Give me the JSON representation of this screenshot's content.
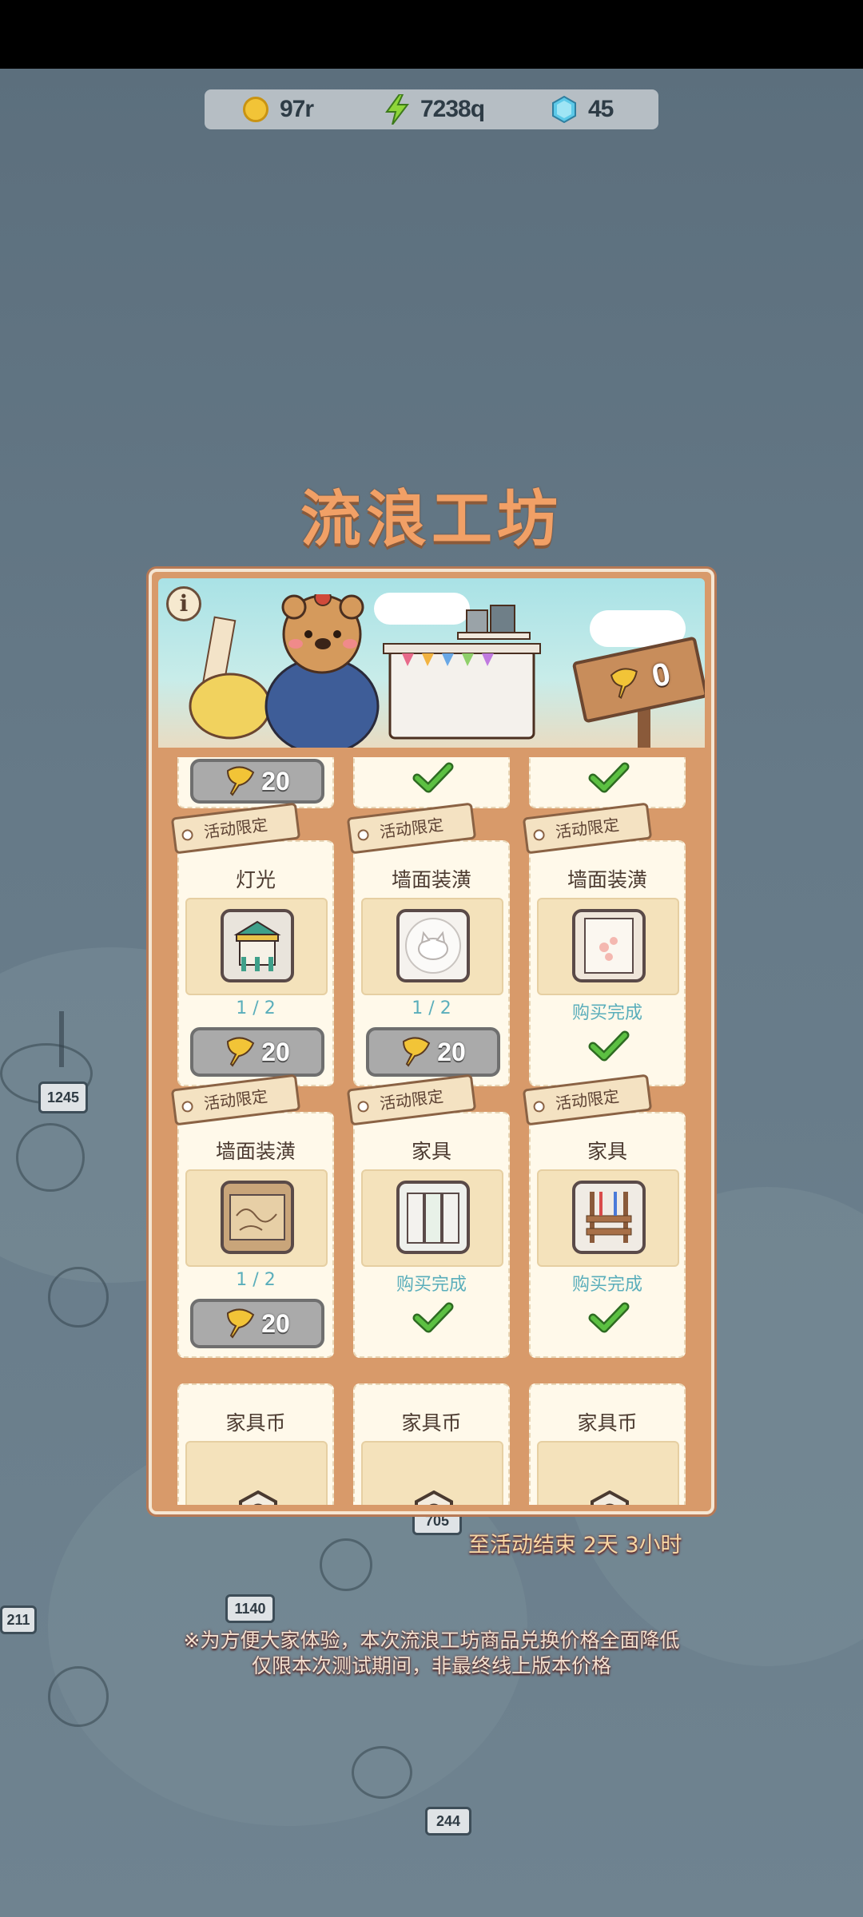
{
  "resources": {
    "coins": "97r",
    "energy": "7238q",
    "gems": "45"
  },
  "title": "流浪工坊",
  "banner": {
    "info_label": "i",
    "counter_value": "0"
  },
  "partial_row": [
    {
      "price": "20"
    }
  ],
  "rows": [
    [
      {
        "tag": "活动限定",
        "category": "灯光",
        "progress": "1 / 2",
        "price": "20"
      },
      {
        "tag": "活动限定",
        "category": "墙面装潢",
        "progress": "1 / 2",
        "price": "20"
      },
      {
        "tag": "活动限定",
        "category": "墙面装潢",
        "status": "购买完成"
      }
    ],
    [
      {
        "tag": "活动限定",
        "category": "墙面装潢",
        "progress": "1 / 2",
        "price": "20"
      },
      {
        "tag": "活动限定",
        "category": "家具",
        "status": "购买完成"
      },
      {
        "tag": "活动限定",
        "category": "家具",
        "status": "购买完成"
      }
    ],
    [
      {
        "category": "家具币"
      },
      {
        "category": "家具币"
      },
      {
        "category": "家具币"
      }
    ]
  ],
  "countdown": "至活动结束  2天 3小时",
  "notice": {
    "line1": "※为方便大家体验，本次流浪工坊商品兑换价格全面降低",
    "line2": "仅限本次测试期间，非最终线上版本价格"
  },
  "background_signs": [
    "1245",
    "705",
    "1140",
    "244",
    "211"
  ],
  "colors": {
    "accent_title": "#f1a066",
    "check_green": "#4cae3a",
    "done_text": "#5aaebb"
  }
}
